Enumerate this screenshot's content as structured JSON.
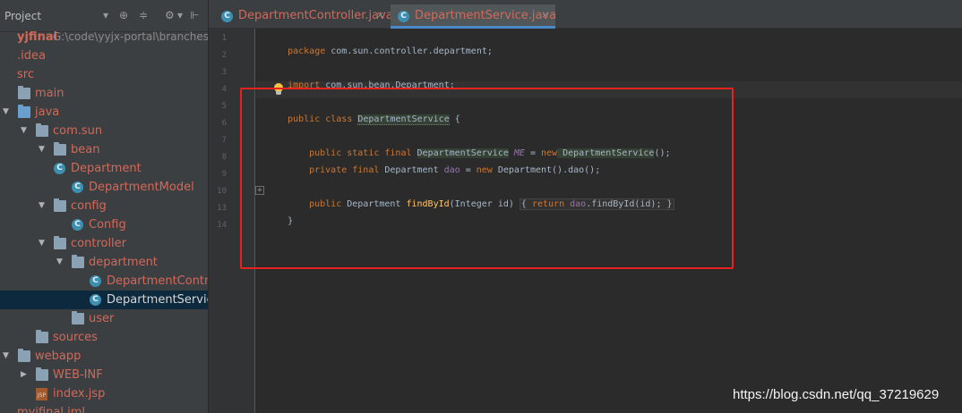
{
  "project_panel": {
    "title": "Project",
    "header_icons": {
      "dropdown": "▾",
      "target": "⊕",
      "collapse": "≑",
      "settings": "⚙",
      "settings_caret": "▾",
      "hide": "⊩"
    },
    "tree": [
      {
        "label": "yjfinal",
        "path": "G:\\code\\yyjx-portal\\branches\\myj",
        "icon": "none",
        "arrow": "",
        "color": "red",
        "bold": true
      },
      {
        "label": ".idea",
        "icon": "none",
        "arrow": "",
        "color": "red"
      },
      {
        "label": "src",
        "icon": "none",
        "arrow": "",
        "color": "red"
      },
      {
        "label": "main",
        "icon": "folder",
        "arrow": "",
        "color": "red"
      },
      {
        "label": "java",
        "icon": "folder-src",
        "arrow": "▼",
        "color": "red"
      },
      {
        "label": "com.sun",
        "icon": "folder",
        "arrow": "▼",
        "color": "red"
      },
      {
        "label": "bean",
        "icon": "folder",
        "arrow": "▼",
        "color": "red"
      },
      {
        "label": "Department",
        "icon": "class",
        "arrow": "",
        "color": "red"
      },
      {
        "label": "DepartmentModel",
        "icon": "class",
        "arrow": "",
        "color": "red"
      },
      {
        "label": "config",
        "icon": "folder",
        "arrow": "▼",
        "color": "red"
      },
      {
        "label": "Config",
        "icon": "class",
        "arrow": "",
        "color": "red"
      },
      {
        "label": "controller",
        "icon": "folder",
        "arrow": "▼",
        "color": "red"
      },
      {
        "label": "department",
        "icon": "folder",
        "arrow": "▼",
        "color": "red"
      },
      {
        "label": "DepartmentControl",
        "icon": "class",
        "arrow": "",
        "color": "red"
      },
      {
        "label": "DepartmentService",
        "icon": "class",
        "arrow": "",
        "color": "white",
        "selected": true
      },
      {
        "label": "user",
        "icon": "folder",
        "arrow": "",
        "color": "red"
      },
      {
        "label": "sources",
        "icon": "folder",
        "arrow": "",
        "color": "red"
      },
      {
        "label": "webapp",
        "icon": "folder",
        "arrow": "▼",
        "color": "red"
      },
      {
        "label": "WEB-INF",
        "icon": "folder",
        "arrow": "▶",
        "color": "red"
      },
      {
        "label": "index.jsp",
        "icon": "jsp",
        "arrow": "",
        "color": "red"
      },
      {
        "label": "myjfinal.iml",
        "icon": "none",
        "arrow": "",
        "color": "red"
      }
    ]
  },
  "tabs": [
    {
      "label": "DepartmentController.java",
      "active": false,
      "icon": "class-icon",
      "close": "×"
    },
    {
      "label": "DepartmentService.java",
      "active": true,
      "icon": "class-icon",
      "close": "×"
    }
  ],
  "editor": {
    "line_numbers": [
      "1",
      "2",
      "3",
      "4",
      "5",
      "6",
      "7",
      "8",
      "9",
      "10",
      "13",
      "14"
    ],
    "code": {
      "l1_kw": "package",
      "l1_rest": " com.sun.controller.department;",
      "l3_kw": "import",
      "l3_rest": " com.sun.bean.Department;",
      "l5_kw": "public class",
      "l5_name": "DepartmentService",
      "l5_rest": " {",
      "l7_kw": "public static final",
      "l7_type": "DepartmentService",
      "l7_const": "ME",
      "l7_eq": " = ",
      "l7_new": "new",
      "l7_ctor": " DepartmentService",
      "l7_end": "();",
      "l8_kw": "private final",
      "l8_type": " Department ",
      "l8_field": "dao",
      "l8_eq": " = ",
      "l8_new": "new",
      "l8_rest": " Department().dao();",
      "l10_kw": "public",
      "l10_type": " Department ",
      "l10_method": "findById",
      "l10_params": "(Integer id) ",
      "l10_open": "{ ",
      "l10_return": "return",
      "l10_field": " dao",
      "l10_call": ".findById(id); ",
      "l10_close": "}",
      "l13": "}"
    },
    "fold_symbol": "+"
  },
  "colors": {
    "annotation_box": "#e8231e",
    "keyword": "#cc7832",
    "method": "#ffc66d",
    "field": "#9876aa",
    "vcs_modified_file": "#d1695a"
  },
  "watermark": "https://blog.csdn.net/qq_37219629"
}
